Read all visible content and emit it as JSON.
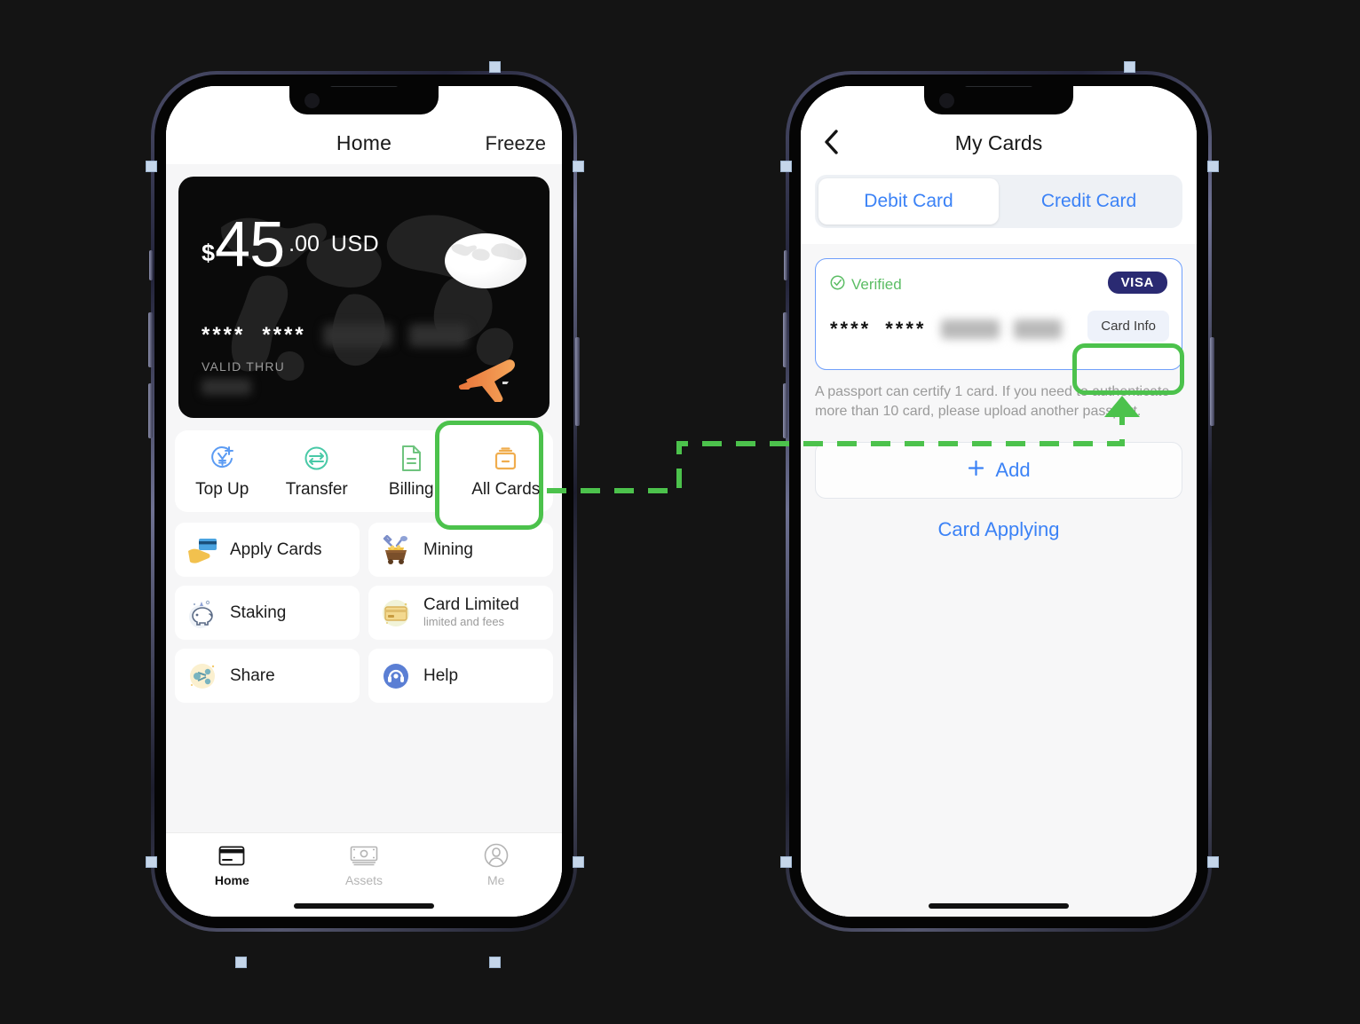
{
  "left_phone": {
    "header": {
      "title": "Home",
      "freeze_action": "Freeze"
    },
    "card": {
      "currency_symbol": "$",
      "amount_integer": "45",
      "amount_decimal": ".00",
      "currency_code": "USD",
      "number_groups": [
        "****",
        "****"
      ],
      "valid_thru_label": "VALID THRU"
    },
    "actions": [
      {
        "label": "Top Up",
        "icon": "yen-plus-circle-icon",
        "color": "#5b9bf3"
      },
      {
        "label": "Transfer",
        "icon": "transfer-arrows-circle-icon",
        "color": "#49c9a7"
      },
      {
        "label": "Billing",
        "icon": "document-lines-icon",
        "color": "#6fc47f"
      },
      {
        "label": "All Cards",
        "icon": "card-wallet-icon",
        "color": "#f0ad4e"
      }
    ],
    "tiles": [
      {
        "title": "Apply Cards",
        "subtitle": "",
        "icon": "hand-card-icon"
      },
      {
        "title": "Mining",
        "subtitle": "",
        "icon": "mine-cart-icon"
      },
      {
        "title": "Staking",
        "subtitle": "",
        "icon": "piggy-bank-icon"
      },
      {
        "title": "Card Limited",
        "subtitle": "limited and fees",
        "icon": "credit-card-coin-icon"
      },
      {
        "title": "Share",
        "subtitle": "",
        "icon": "share-nodes-icon"
      },
      {
        "title": "Help",
        "subtitle": "",
        "icon": "headset-support-icon"
      }
    ],
    "tabbar": [
      {
        "label": "Home",
        "icon": "card-icon",
        "active": true
      },
      {
        "label": "Assets",
        "icon": "banknote-icon",
        "active": false
      },
      {
        "label": "Me",
        "icon": "person-circle-icon",
        "active": false
      }
    ]
  },
  "right_phone": {
    "header": {
      "title": "My Cards",
      "back_icon": "chevron-left-icon"
    },
    "segments": [
      {
        "label": "Debit Card",
        "active": true
      },
      {
        "label": "Credit Card",
        "active": false
      }
    ],
    "card": {
      "status": "Verified",
      "status_icon": "check-circle-icon",
      "brand": "VISA",
      "number_groups": [
        "****",
        "****"
      ],
      "card_info_button": "Card Info"
    },
    "hint": "A passport can certify 1 card. If you need to authenticate more than 10 card, please upload another passport.",
    "add_button": "Add",
    "add_icon": "plus-icon",
    "card_applying_link": "Card Applying"
  },
  "annotation": {
    "highlight_color": "#4cc24c",
    "connector_style": "dashed",
    "from": "All Cards",
    "to": "Card Info"
  },
  "colors": {
    "background": "#141414",
    "accent_blue": "#3b82f6",
    "verified_green": "#5bbd64",
    "visa_navy": "#2a2a72",
    "highlight_green": "#4cc24c"
  }
}
